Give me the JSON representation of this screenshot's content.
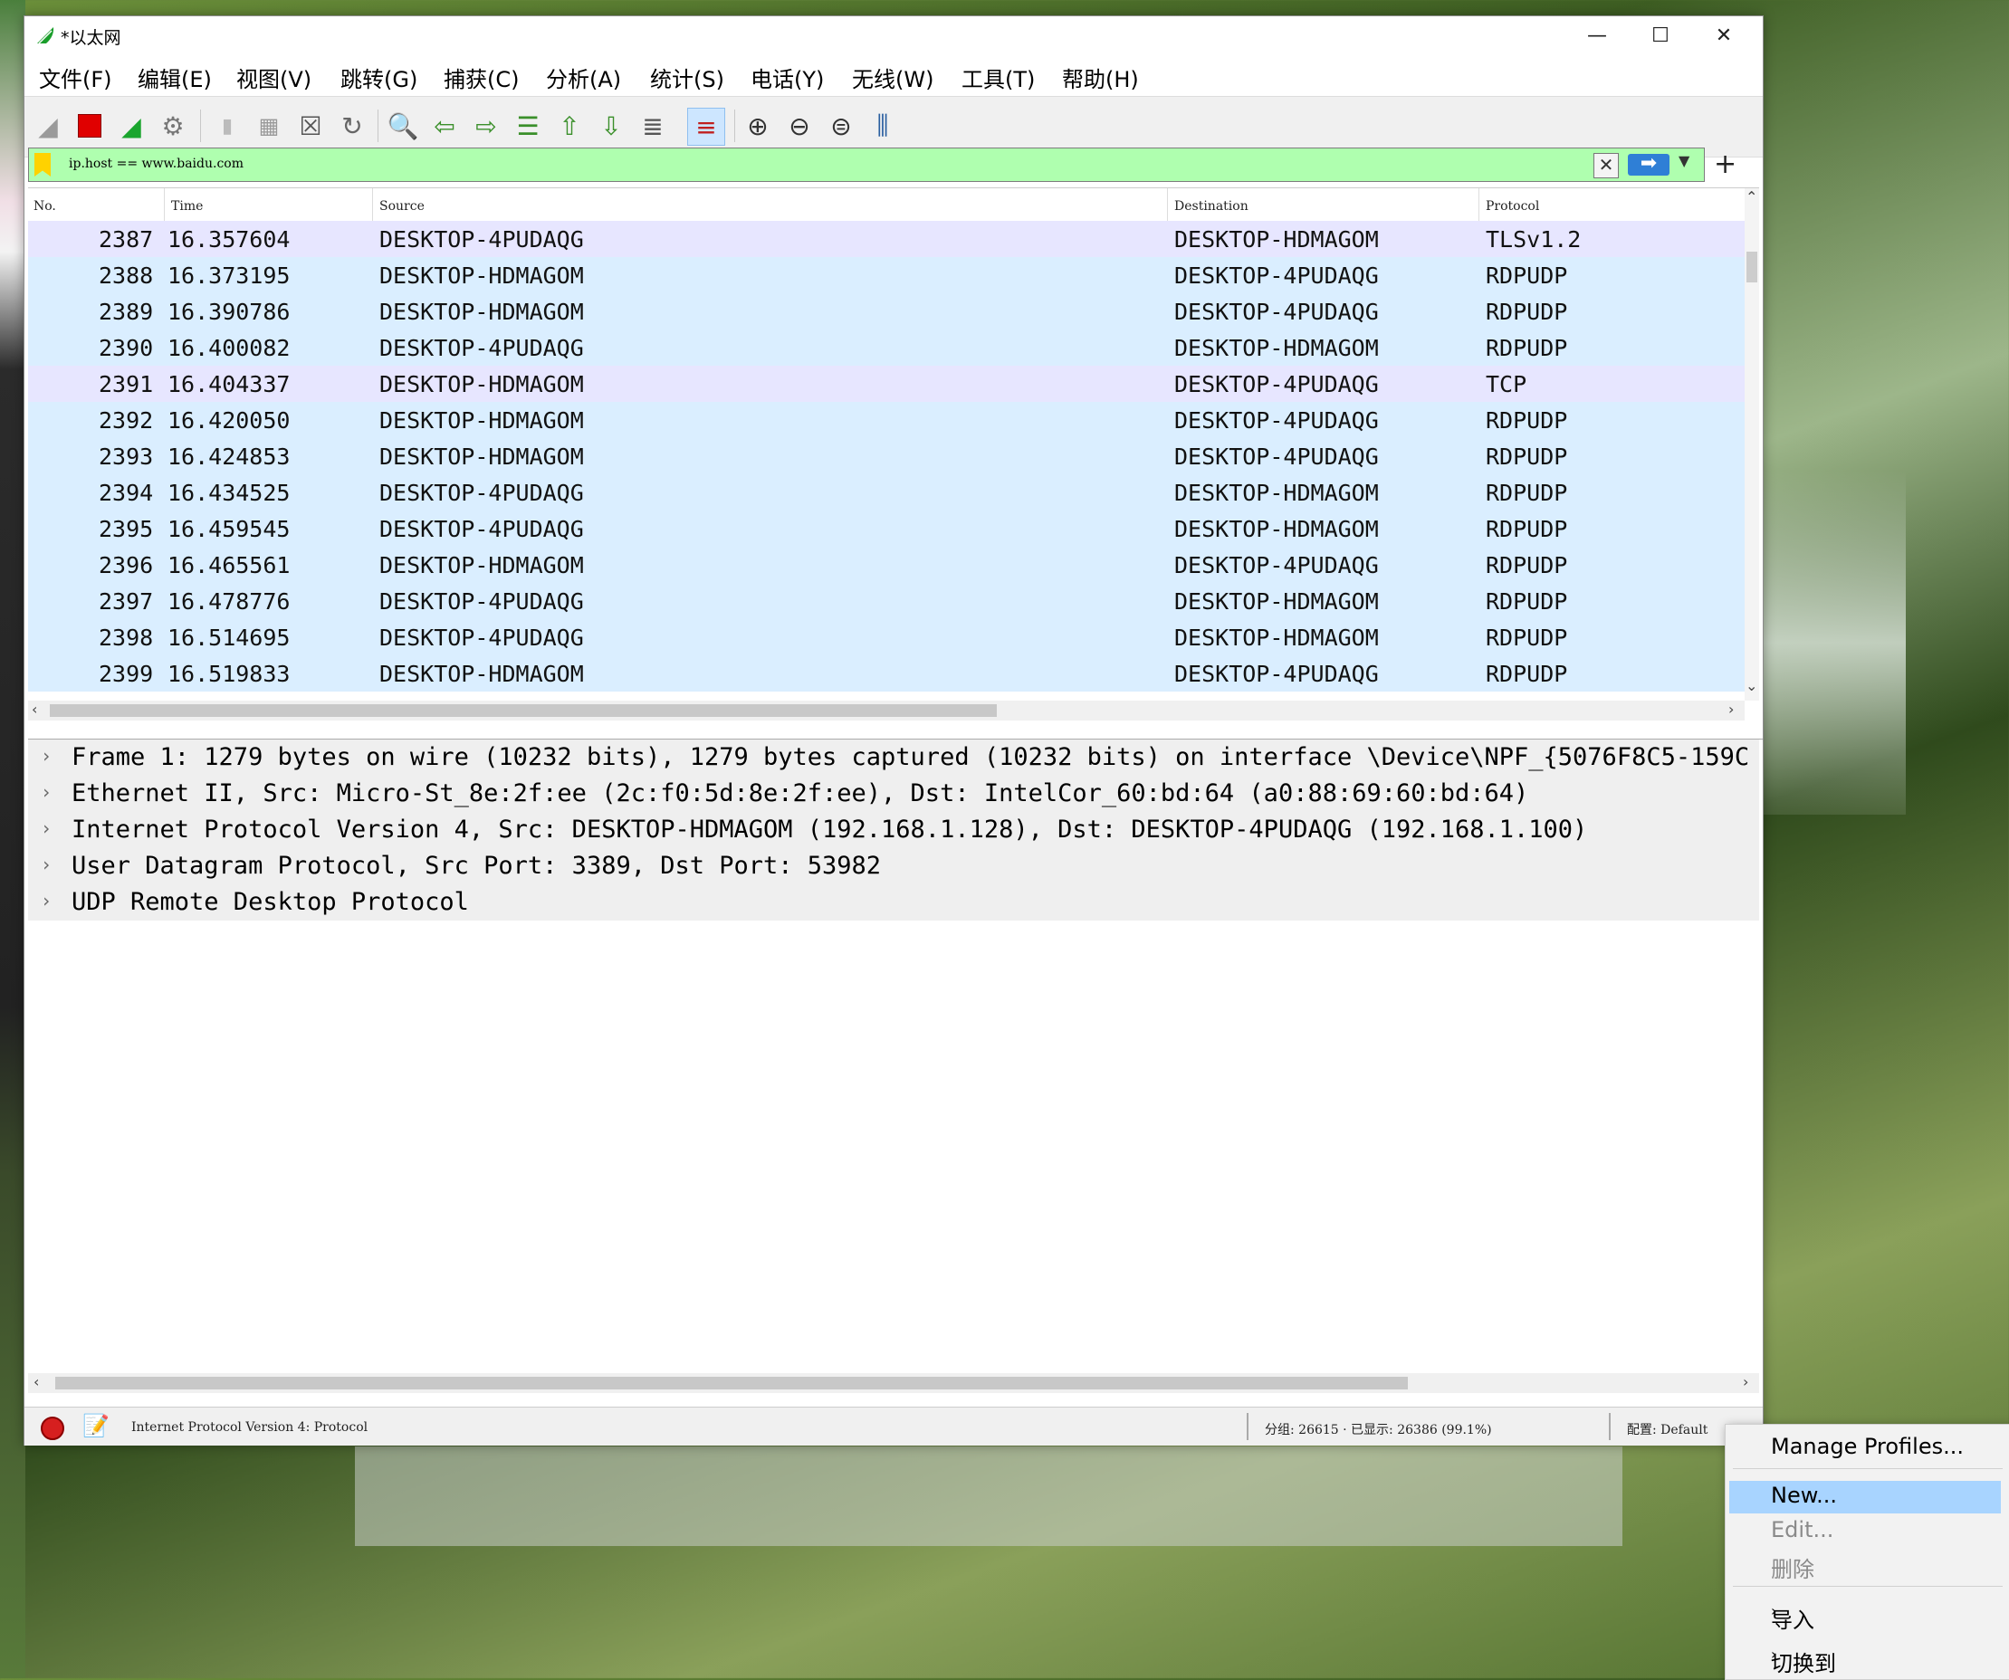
{
  "window": {
    "title": "*以太网"
  },
  "menu": [
    "文件(F)",
    "编辑(E)",
    "视图(V)",
    "跳转(G)",
    "捕获(C)",
    "分析(A)",
    "统计(S)",
    "电话(Y)",
    "无线(W)",
    "工具(T)",
    "帮助(H)"
  ],
  "toolbar": {
    "buttons": [
      "shark-fin-start-icon",
      "stop-capture-icon",
      "restart-capture-icon",
      "capture-options-icon",
      "open-file-icon",
      "save-file-icon",
      "close-file-icon",
      "reload-file-icon",
      "find-packet-icon",
      "go-back-icon",
      "go-forward-icon",
      "go-to-packet-icon",
      "go-first-icon",
      "go-last-icon",
      "auto-scroll-icon",
      "colorize-icon",
      "zoom-in-icon",
      "zoom-out-icon",
      "zoom-normal-icon",
      "resize-columns-icon"
    ]
  },
  "filter": {
    "value": "ip.host == www.baidu.com",
    "bookmark_color": "#ffd200",
    "bg_color": "#afffaf"
  },
  "columns": {
    "no": "No.",
    "time": "Time",
    "source": "Source",
    "destination": "Destination",
    "protocol": "Protocol"
  },
  "packets": [
    {
      "no": "2387",
      "time": "16.357604",
      "src": "DESKTOP-4PUDAQG",
      "dst": "DESKTOP-HDMAGOM",
      "proto": "TLSv1.2",
      "kind": "tls"
    },
    {
      "no": "2388",
      "time": "16.373195",
      "src": "DESKTOP-HDMAGOM",
      "dst": "DESKTOP-4PUDAQG",
      "proto": "RDPUDP",
      "kind": "udp"
    },
    {
      "no": "2389",
      "time": "16.390786",
      "src": "DESKTOP-HDMAGOM",
      "dst": "DESKTOP-4PUDAQG",
      "proto": "RDPUDP",
      "kind": "udp"
    },
    {
      "no": "2390",
      "time": "16.400082",
      "src": "DESKTOP-4PUDAQG",
      "dst": "DESKTOP-HDMAGOM",
      "proto": "RDPUDP",
      "kind": "udp"
    },
    {
      "no": "2391",
      "time": "16.404337",
      "src": "DESKTOP-HDMAGOM",
      "dst": "DESKTOP-4PUDAQG",
      "proto": "TCP",
      "kind": "tcp"
    },
    {
      "no": "2392",
      "time": "16.420050",
      "src": "DESKTOP-HDMAGOM",
      "dst": "DESKTOP-4PUDAQG",
      "proto": "RDPUDP",
      "kind": "udp"
    },
    {
      "no": "2393",
      "time": "16.424853",
      "src": "DESKTOP-HDMAGOM",
      "dst": "DESKTOP-4PUDAQG",
      "proto": "RDPUDP",
      "kind": "udp"
    },
    {
      "no": "2394",
      "time": "16.434525",
      "src": "DESKTOP-4PUDAQG",
      "dst": "DESKTOP-HDMAGOM",
      "proto": "RDPUDP",
      "kind": "udp"
    },
    {
      "no": "2395",
      "time": "16.459545",
      "src": "DESKTOP-4PUDAQG",
      "dst": "DESKTOP-HDMAGOM",
      "proto": "RDPUDP",
      "kind": "udp"
    },
    {
      "no": "2396",
      "time": "16.465561",
      "src": "DESKTOP-HDMAGOM",
      "dst": "DESKTOP-4PUDAQG",
      "proto": "RDPUDP",
      "kind": "udp"
    },
    {
      "no": "2397",
      "time": "16.478776",
      "src": "DESKTOP-4PUDAQG",
      "dst": "DESKTOP-HDMAGOM",
      "proto": "RDPUDP",
      "kind": "udp"
    },
    {
      "no": "2398",
      "time": "16.514695",
      "src": "DESKTOP-4PUDAQG",
      "dst": "DESKTOP-HDMAGOM",
      "proto": "RDPUDP",
      "kind": "udp"
    },
    {
      "no": "2399",
      "time": "16.519833",
      "src": "DESKTOP-HDMAGOM",
      "dst": "DESKTOP-4PUDAQG",
      "proto": "RDPUDP",
      "kind": "udp"
    }
  ],
  "details": [
    "Frame 1: 1279 bytes on wire (10232 bits), 1279 bytes captured (10232 bits) on interface \\Device\\NPF_{5076F8C5-159C",
    "Ethernet II, Src: Micro-St_8e:2f:ee (2c:f0:5d:8e:2f:ee), Dst: IntelCor_60:bd:64 (a0:88:69:60:bd:64)",
    "Internet Protocol Version 4, Src: DESKTOP-HDMAGOM (192.168.1.128), Dst: DESKTOP-4PUDAQG (192.168.1.100)",
    "User Datagram Protocol, Src Port: 3389, Dst Port: 53982",
    "UDP Remote Desktop Protocol"
  ],
  "status": {
    "field_info": "Internet Protocol Version 4: Protocol",
    "packet_count": "分组: 26615 · 已显示: 26386 (99.1%)",
    "profile": "配置: Default"
  },
  "context_menu": {
    "items": [
      {
        "label": "Manage Profiles...",
        "state": "normal"
      },
      {
        "label": "New...",
        "state": "highlighted"
      },
      {
        "label": "Edit...",
        "state": "disabled"
      },
      {
        "label": "删除",
        "state": "disabled"
      },
      {
        "label": "导入",
        "state": "submenu"
      },
      {
        "label": "切换到",
        "state": "submenu"
      }
    ]
  },
  "colors": {
    "tls_row": "#e7e6ff",
    "udp_row": "#daeeff",
    "menu_highlight": "#a8d4ff"
  }
}
